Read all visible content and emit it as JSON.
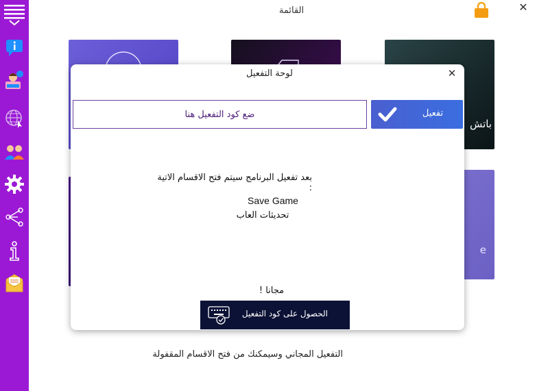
{
  "header": {
    "title": "القائمة"
  },
  "sidebar": {
    "items": [
      {
        "icon": "menu-collapse-icon"
      },
      {
        "icon": "info-chat-icon"
      },
      {
        "icon": "reporter-icon"
      },
      {
        "icon": "globe-icon"
      },
      {
        "icon": "users-icon"
      },
      {
        "icon": "gear-icon"
      },
      {
        "icon": "share-icon"
      },
      {
        "icon": "info-icon"
      },
      {
        "icon": "mail-icon"
      }
    ]
  },
  "tiles": {
    "tile3_text": "باتش",
    "tile5_text": "e"
  },
  "dialog": {
    "title": "لوحة التفعيل",
    "input_placeholder": "ضع كود التفعيل هنا",
    "activate_label": "تفعيل",
    "info_line": "بعد تفعيل البرنامج سيتم فتح الاقسام الاتية :",
    "sections": [
      "Save Game",
      "تحديثات العاب"
    ],
    "free_text": "مجانا !",
    "get_code_label": "الحصول على كود التفعيل"
  },
  "bottom_text": "التفعيل المجاني وسيمكنك من فتح الاقسام المقفولة",
  "colors": {
    "sidebar": "#9b19d4",
    "activate_button": "#3a6ee0",
    "get_code_button": "#0c1236",
    "input_border": "#6b3fa0"
  }
}
